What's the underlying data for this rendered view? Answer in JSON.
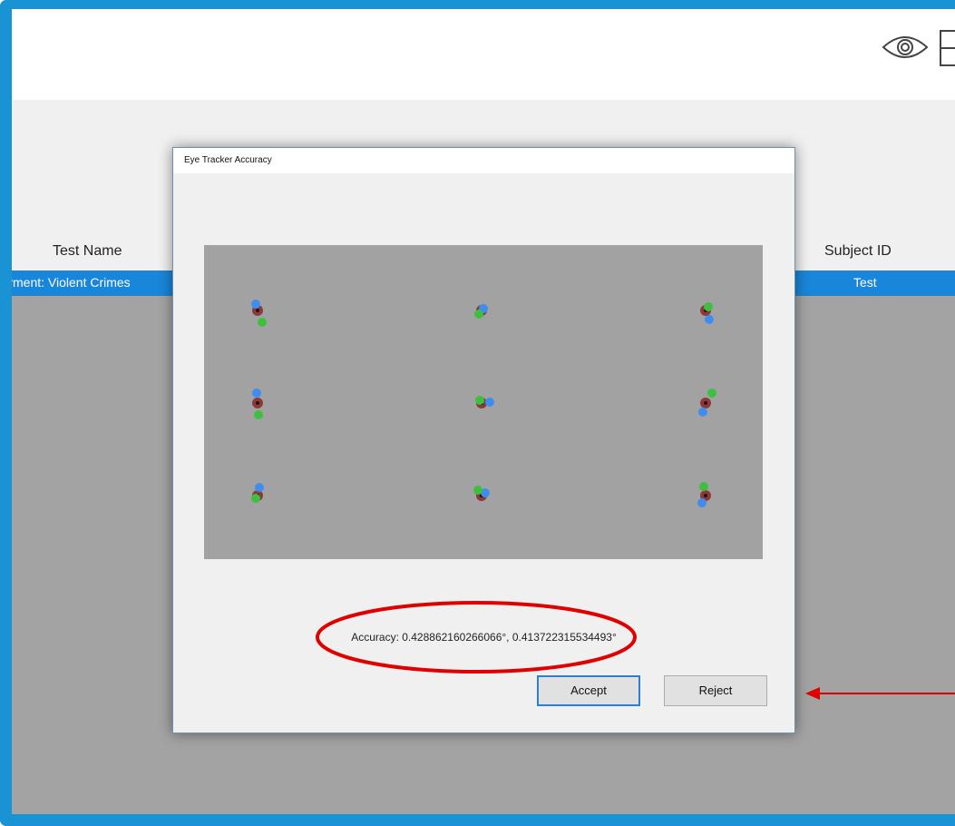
{
  "header": {
    "icons": [
      "eye-icon",
      "layout-icon"
    ]
  },
  "table": {
    "columns": {
      "test_name": "Test Name",
      "subject_id": "Subject ID"
    },
    "selected_row": {
      "test_name": "yment: Violent Crimes",
      "subject_id": "Test"
    }
  },
  "dialog": {
    "title": "Eye Tracker Accuracy",
    "accuracy_text": "Accuracy: 0.428862160266066°, 0.413722315534493°",
    "accept_label": "Accept",
    "reject_label": "Reject"
  },
  "calibration": {
    "colors": {
      "target": "#8b3a3a",
      "left_eye": "#3f8df0",
      "right_eye": "#3fbf3f",
      "plot_bg": "#a2a2a2"
    },
    "targets": [
      {
        "row": 0,
        "col": 0,
        "left_eye": [
          -2,
          -7
        ],
        "right_eye": [
          5,
          13
        ]
      },
      {
        "row": 0,
        "col": 1,
        "left_eye": [
          2,
          -2
        ],
        "right_eye": [
          -3,
          4
        ]
      },
      {
        "row": 0,
        "col": 2,
        "left_eye": [
          4,
          10
        ],
        "right_eye": [
          3,
          -4
        ]
      },
      {
        "row": 1,
        "col": 0,
        "left_eye": [
          -1,
          -11
        ],
        "right_eye": [
          1,
          13
        ]
      },
      {
        "row": 1,
        "col": 1,
        "left_eye": [
          9,
          -1
        ],
        "right_eye": [
          -2,
          -3
        ]
      },
      {
        "row": 1,
        "col": 2,
        "left_eye": [
          -3,
          10
        ],
        "right_eye": [
          7,
          -11
        ]
      },
      {
        "row": 2,
        "col": 0,
        "left_eye": [
          2,
          -9
        ],
        "right_eye": [
          -2,
          3
        ]
      },
      {
        "row": 2,
        "col": 1,
        "left_eye": [
          4,
          -3
        ],
        "right_eye": [
          -4,
          -6
        ]
      },
      {
        "row": 2,
        "col": 2,
        "left_eye": [
          -4,
          8
        ],
        "right_eye": [
          -2,
          -10
        ]
      }
    ]
  },
  "annotations": {
    "highlight_color": "#e00000"
  }
}
